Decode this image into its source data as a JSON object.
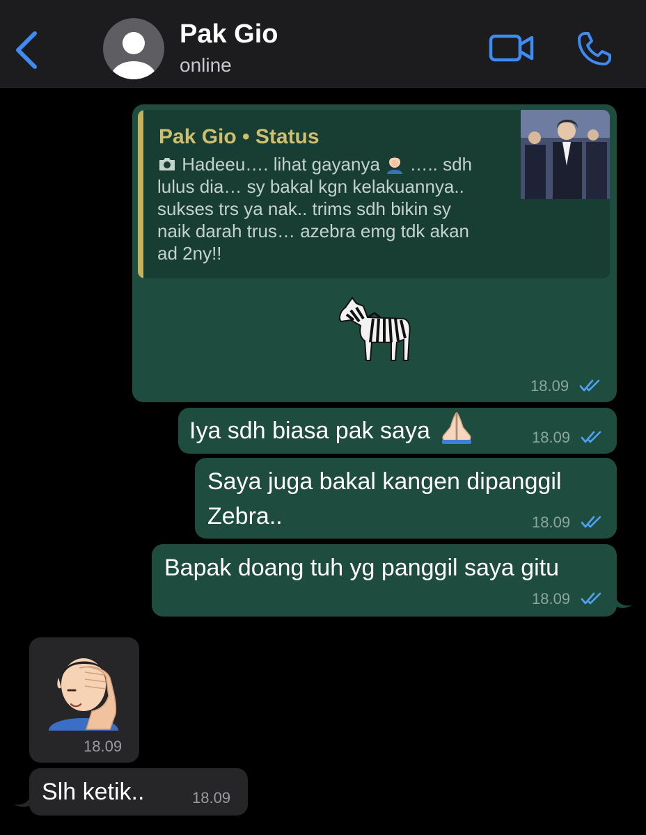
{
  "header": {
    "back_label": "",
    "contact_name": "Pak Gio",
    "status": "online"
  },
  "messages": [
    {
      "type": "reply",
      "quote_title": "Pak Gio • Status",
      "quote_lines": [
        "Hadeeu…. lihat gayanya",
        "….. sdh",
        "lulus dia… sy bakal kgn kelakuannya..",
        "sukses trs ya nak.. trims sdh bikin sy",
        "naik darah trus… azebra emg tdk akan",
        "ad 2ny!!"
      ],
      "body_emoji": "zebra",
      "time": "18.09"
    },
    {
      "type": "text",
      "text": "Iya sdh biasa pak saya",
      "emoji": "folded-hands",
      "time": "18.09"
    },
    {
      "type": "text",
      "lines": [
        "Saya juga bakal kangen dipanggil",
        "Zebra.."
      ],
      "time": "18.09"
    },
    {
      "type": "text",
      "text": "Bapak doang tuh yg panggil saya gitu",
      "time": "18.09"
    },
    {
      "type": "sticker",
      "emoji": "face-palm",
      "time": "18.09"
    },
    {
      "type": "text",
      "text": "Slh ketik..",
      "time": "18.09"
    }
  ],
  "colors": {
    "outgoing_bubble": "#1e4d40",
    "incoming_bubble": "#262628",
    "accent_blue": "#3e8bf4",
    "quote_accent": "#c3b35e"
  }
}
